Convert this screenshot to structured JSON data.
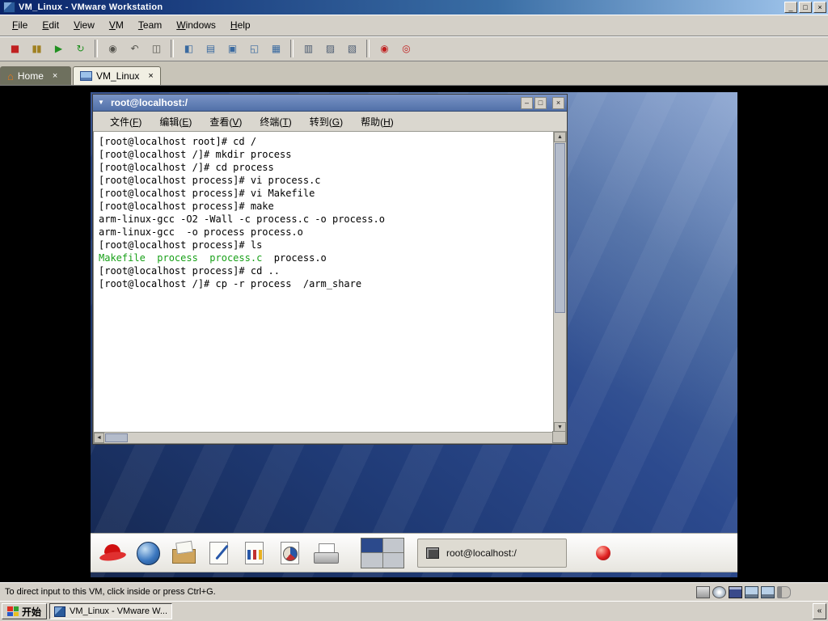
{
  "titlebar": {
    "title": "VM_Linux - VMware Workstation",
    "minimize": "_",
    "maximize": "□",
    "close": "×"
  },
  "menubar": {
    "items": [
      {
        "label": "File",
        "u": 0,
        "name": "file"
      },
      {
        "label": "Edit",
        "u": 0,
        "name": "edit"
      },
      {
        "label": "View",
        "u": 0,
        "name": "view"
      },
      {
        "label": "VM",
        "u": 0,
        "name": "vm"
      },
      {
        "label": "Team",
        "u": 0,
        "name": "team"
      },
      {
        "label": "Windows",
        "u": 0,
        "name": "windows"
      },
      {
        "label": "Help",
        "u": 0,
        "name": "help"
      }
    ]
  },
  "toolbar": {
    "groups": [
      [
        {
          "name": "power-off",
          "glyph": "■",
          "color": "#c02020"
        },
        {
          "name": "suspend",
          "glyph": "▮▮",
          "color": "#a08020"
        },
        {
          "name": "power-on",
          "glyph": "▶",
          "color": "#209020"
        },
        {
          "name": "reset",
          "glyph": "↻",
          "color": "#209020"
        }
      ],
      [
        {
          "name": "take-snapshot",
          "glyph": "◉",
          "color": "#55544e"
        },
        {
          "name": "revert-snapshot",
          "glyph": "↶",
          "color": "#55544e"
        },
        {
          "name": "snapshot-manager",
          "glyph": "◫",
          "color": "#55544e"
        }
      ],
      [
        {
          "name": "show-sidebar",
          "glyph": "◧",
          "color": "#3a6aa0"
        },
        {
          "name": "summary-view",
          "glyph": "▤",
          "color": "#3a6aa0"
        },
        {
          "name": "console-view",
          "glyph": "▣",
          "color": "#3a6aa0"
        },
        {
          "name": "fullscreen",
          "glyph": "◱",
          "color": "#3a6aa0"
        },
        {
          "name": "quick-switch",
          "glyph": "▦",
          "color": "#3a6aa0"
        }
      ],
      [
        {
          "name": "summary-tab",
          "glyph": "▥",
          "color": "#4a5a70"
        },
        {
          "name": "appliance-view",
          "glyph": "▨",
          "color": "#4a5a70"
        },
        {
          "name": "console-tab",
          "glyph": "▧",
          "color": "#4a5a70"
        }
      ],
      [
        {
          "name": "capture-screen",
          "glyph": "◉",
          "color": "#c02020"
        },
        {
          "name": "capture-movie",
          "glyph": "◎",
          "color": "#c02020"
        }
      ]
    ]
  },
  "tabs": [
    {
      "label": "Home",
      "close": "×"
    },
    {
      "label": "VM_Linux",
      "close": "×"
    }
  ],
  "terminal": {
    "title": "root@localhost:/",
    "chevron": "▼",
    "controls": {
      "minimize": "–",
      "maximize": "□",
      "close": "×"
    },
    "menu": [
      {
        "label": "文件(F)",
        "u": 3,
        "name": "file"
      },
      {
        "label": "编辑(E)",
        "u": 3,
        "name": "edit"
      },
      {
        "label": "查看(V)",
        "u": 3,
        "name": "view"
      },
      {
        "label": "终端(T)",
        "u": 3,
        "name": "terminal"
      },
      {
        "label": "转到(G)",
        "u": 3,
        "name": "goto"
      },
      {
        "label": "帮助(H)",
        "u": 3,
        "name": "help"
      }
    ],
    "scroll": {
      "up": "▲",
      "down": "▼",
      "left": "◄",
      "right": "►"
    },
    "colors": {
      "g": "#18a018"
    },
    "lines": [
      [
        {
          "t": "[root@localhost root]# cd /"
        }
      ],
      [
        {
          "t": "[root@localhost /]# mkdir process"
        }
      ],
      [
        {
          "t": "[root@localhost /]# cd process"
        }
      ],
      [
        {
          "t": "[root@localhost process]# vi process.c"
        }
      ],
      [
        {
          "t": "[root@localhost process]# vi Makefile"
        }
      ],
      [
        {
          "t": "[root@localhost process]# make"
        }
      ],
      [
        {
          "t": "arm-linux-gcc -O2 -Wall -c process.c -o process.o"
        }
      ],
      [
        {
          "t": "arm-linux-gcc  -o process process.o"
        }
      ],
      [
        {
          "t": "[root@localhost process]# ls"
        }
      ],
      [
        {
          "t": "Makefile",
          "c": "g"
        },
        {
          "t": "  "
        },
        {
          "t": "process",
          "c": "g"
        },
        {
          "t": "  "
        },
        {
          "t": "process.c",
          "c": "g"
        },
        {
          "t": "  process.o"
        }
      ],
      [
        {
          "t": "[root@localhost process]# cd .."
        }
      ],
      [
        {
          "t": "[root@localhost /]# cp -r process  /arm_share"
        }
      ]
    ]
  },
  "vm_panel": {
    "launchers": [
      {
        "name": "redhat-menu"
      },
      {
        "name": "web-browser"
      },
      {
        "name": "email"
      },
      {
        "name": "writer"
      },
      {
        "name": "calc"
      },
      {
        "name": "impress"
      },
      {
        "name": "printer"
      }
    ],
    "window_button": "root@localhost:/"
  },
  "statusbar": {
    "message": "To direct input to this VM, click inside or press Ctrl+G.",
    "devices": [
      "harddisk",
      "cdrom",
      "floppy",
      "network",
      "network2",
      "sound"
    ]
  },
  "taskbar": {
    "start_label": "开始",
    "task_label": "VM_Linux - VMware W...",
    "overflow": "«"
  }
}
